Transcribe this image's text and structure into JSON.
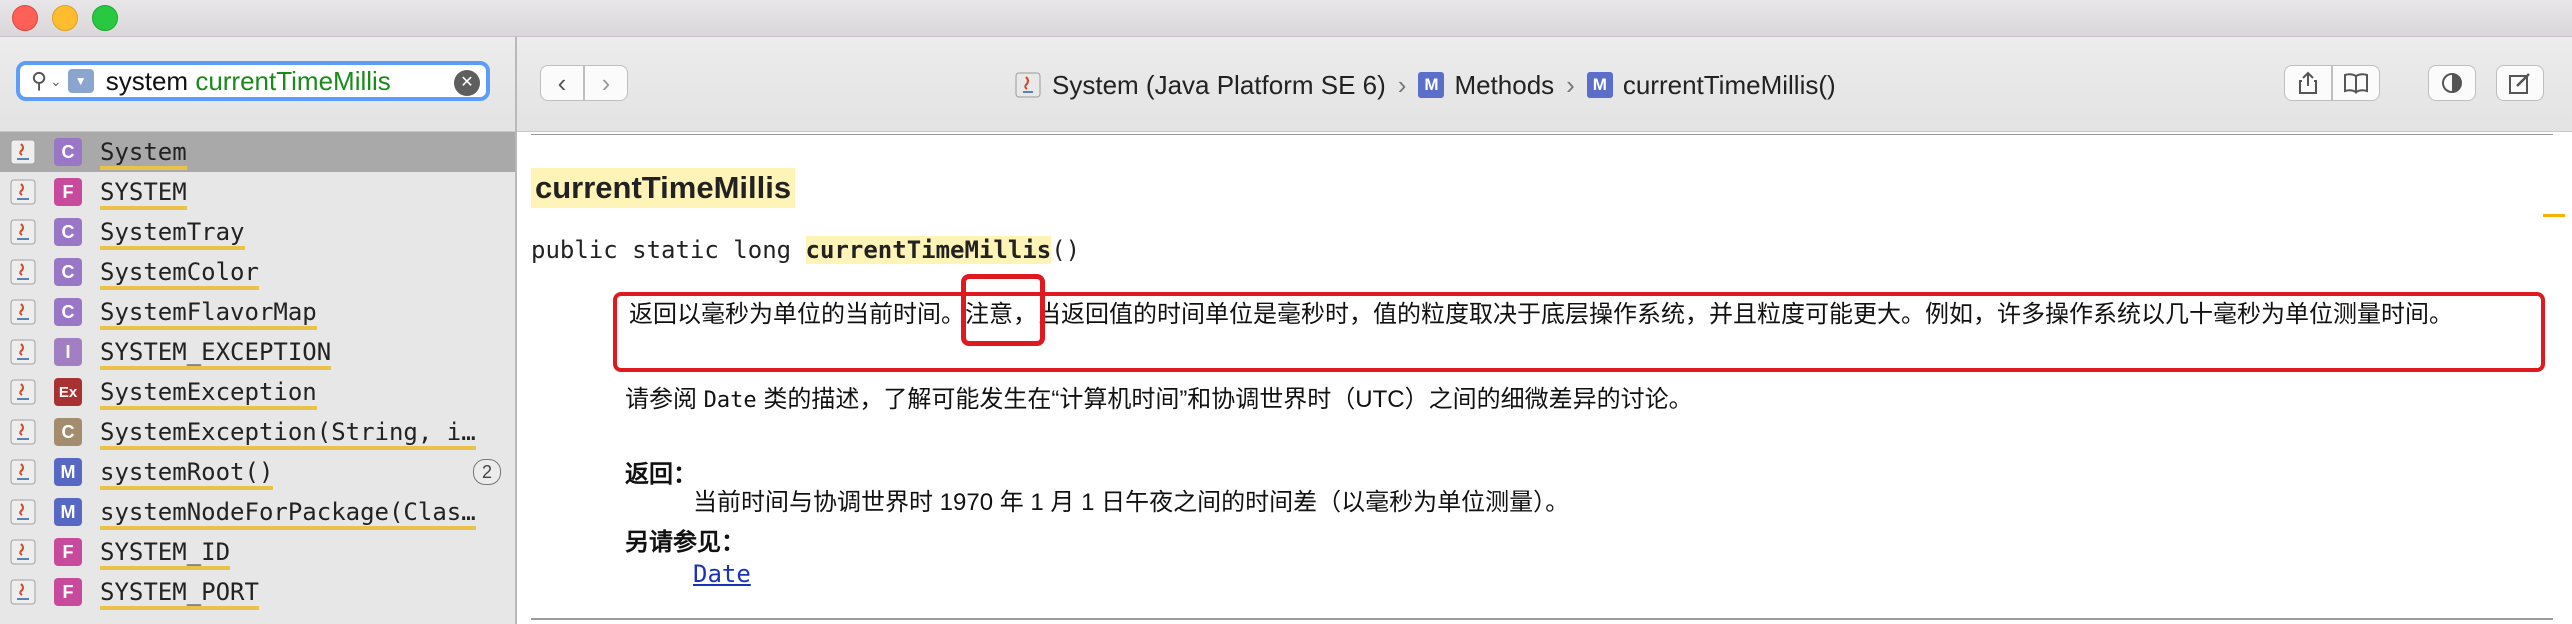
{
  "search": {
    "query_prefix": "system ",
    "query_match": "currentTimeMillis"
  },
  "breadcrumb": {
    "class": "System (Java Platform SE 6)",
    "section_badge": "M",
    "section": "Methods",
    "method_badge": "M",
    "method": "currentTimeMillis()"
  },
  "sidebar": {
    "items": [
      {
        "kind": "C",
        "name": "System",
        "selected": true
      },
      {
        "kind": "F",
        "name": "SYSTEM"
      },
      {
        "kind": "C",
        "name": "SystemTray"
      },
      {
        "kind": "C",
        "name": "SystemColor"
      },
      {
        "kind": "C",
        "name": "SystemFlavorMap"
      },
      {
        "kind": "I",
        "name": "SYSTEM_EXCEPTION"
      },
      {
        "kind": "Ex",
        "name": "SystemException"
      },
      {
        "kind": "C",
        "name": "SystemException(String, i…"
      },
      {
        "kind": "M",
        "name": "systemRoot()",
        "badge": "2"
      },
      {
        "kind": "M",
        "name": "systemNodeForPackage(Clas…"
      },
      {
        "kind": "F",
        "name": "SYSTEM_ID"
      },
      {
        "kind": "F",
        "name": "SYSTEM_PORT"
      }
    ]
  },
  "doc": {
    "heading": "currentTimeMillis",
    "signature_prefix": "public static long ",
    "signature_name": "currentTimeMillis",
    "signature_suffix": "()",
    "description": "返回以毫秒为单位的当前时间。注意，当返回值的时间单位是毫秒时，值的粒度取决于底层操作系统，并且粒度可能更大。例如，许多操作系统以几十毫秒为单位测量时间。",
    "see_prefix": "请参阅 ",
    "see_class": "Date",
    "see_suffix": " 类的描述，了解可能发生在“计算机时间”和协调世界时（UTC）之间的细微差异的讨论。",
    "returns_label": "返回：",
    "returns_text": "当前时间与协调世界时 1970 年 1 月 1 日午夜之间的时间差（以毫秒为单位测量）。",
    "see_also_label": "另请参见：",
    "see_also_link": "Date"
  },
  "colors": {
    "highlight_box": "#e0191f",
    "search_focus": "#5b9df9",
    "selected_row": "#a9a9a9"
  }
}
